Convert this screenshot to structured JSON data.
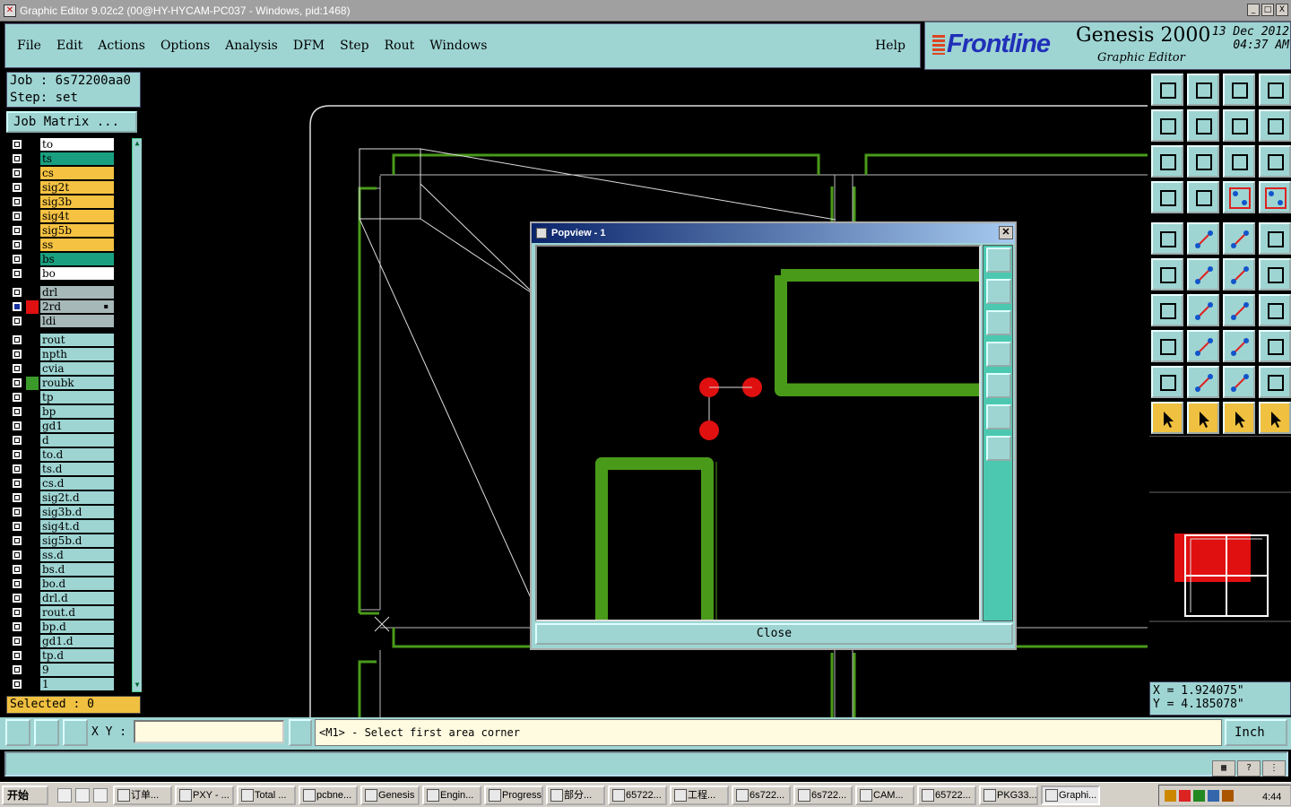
{
  "window": {
    "title": "Graphic Editor 9.02c2 (00@HY-HYCAM-PC037 - Windows, pid:1468)",
    "min": "_",
    "max": "□",
    "close": "X"
  },
  "menu": {
    "items": [
      "File",
      "Edit",
      "Actions",
      "Options",
      "Analysis",
      "DFM",
      "Step",
      "Rout",
      "Windows"
    ],
    "help": "Help"
  },
  "brand": {
    "logo": "Frontline",
    "product": "Genesis 2000",
    "subtitle": "Graphic Editor",
    "date": "13 Dec 2012",
    "time": "04:37 AM"
  },
  "job": {
    "job_label": "Job :",
    "job_name": "6s72200aa0",
    "step_label": "Step:",
    "step_name": "set",
    "matrix_button": "Job Matrix ..."
  },
  "layers": [
    {
      "name": "to",
      "color": "#ffffff",
      "sw": ""
    },
    {
      "name": "ts",
      "color": "#1aa080",
      "sw": ""
    },
    {
      "name": "cs",
      "color": "#f5c242",
      "sw": ""
    },
    {
      "name": "sig2t",
      "color": "#f5c242",
      "sw": ""
    },
    {
      "name": "sig3b",
      "color": "#f5c242",
      "sw": ""
    },
    {
      "name": "sig4t",
      "color": "#f5c242",
      "sw": ""
    },
    {
      "name": "sig5b",
      "color": "#f5c242",
      "sw": ""
    },
    {
      "name": "ss",
      "color": "#f5c242",
      "sw": ""
    },
    {
      "name": "bs",
      "color": "#1aa080",
      "sw": ""
    },
    {
      "name": "bo",
      "color": "#ffffff",
      "sw": ""
    },
    {
      "name": "drl",
      "color": "#a6b8b8",
      "sw": "",
      "gap": true
    },
    {
      "name": "2rd",
      "color": "#a6b8b8",
      "sw": "#e01010",
      "sel": true
    },
    {
      "name": "ldi",
      "color": "#a6b8b8",
      "sw": ""
    },
    {
      "name": "rout",
      "color": "#9ed5d3",
      "sw": "",
      "gap": true
    },
    {
      "name": "npth",
      "color": "#9ed5d3",
      "sw": ""
    },
    {
      "name": "cvia",
      "color": "#9ed5d3",
      "sw": ""
    },
    {
      "name": "roubk",
      "color": "#9ed5d3",
      "sw": "#3a9a2a"
    },
    {
      "name": "tp",
      "color": "#9ed5d3",
      "sw": ""
    },
    {
      "name": "bp",
      "color": "#9ed5d3",
      "sw": ""
    },
    {
      "name": "gd1",
      "color": "#9ed5d3",
      "sw": ""
    },
    {
      "name": "d",
      "color": "#9ed5d3",
      "sw": ""
    },
    {
      "name": "to.d",
      "color": "#9ed5d3",
      "sw": ""
    },
    {
      "name": "ts.d",
      "color": "#9ed5d3",
      "sw": ""
    },
    {
      "name": "cs.d",
      "color": "#9ed5d3",
      "sw": ""
    },
    {
      "name": "sig2t.d",
      "color": "#9ed5d3",
      "sw": ""
    },
    {
      "name": "sig3b.d",
      "color": "#9ed5d3",
      "sw": ""
    },
    {
      "name": "sig4t.d",
      "color": "#9ed5d3",
      "sw": ""
    },
    {
      "name": "sig5b.d",
      "color": "#9ed5d3",
      "sw": ""
    },
    {
      "name": "ss.d",
      "color": "#9ed5d3",
      "sw": ""
    },
    {
      "name": "bs.d",
      "color": "#9ed5d3",
      "sw": ""
    },
    {
      "name": "bo.d",
      "color": "#9ed5d3",
      "sw": ""
    },
    {
      "name": "drl.d",
      "color": "#9ed5d3",
      "sw": ""
    },
    {
      "name": "rout.d",
      "color": "#9ed5d3",
      "sw": ""
    },
    {
      "name": "bp.d",
      "color": "#9ed5d3",
      "sw": ""
    },
    {
      "name": "gd1.d",
      "color": "#9ed5d3",
      "sw": ""
    },
    {
      "name": "tp.d",
      "color": "#9ed5d3",
      "sw": ""
    },
    {
      "name": "9",
      "color": "#9ed5d3",
      "sw": ""
    },
    {
      "name": "1",
      "color": "#9ed5d3",
      "sw": ""
    }
  ],
  "selected": "Selected : 0",
  "popview": {
    "title": "Popview - 1",
    "close_button": "Close"
  },
  "coords": {
    "x": "X = 1.924075\"",
    "y": "Y = 4.185078\""
  },
  "bottom": {
    "xy_label": "X Y :",
    "xy_value": "",
    "message": "<M1> - Select first area corner",
    "units": "Inch"
  },
  "taskbar": {
    "start": "开始",
    "tasks": [
      "订单...",
      "PXY - ...",
      "Total ...",
      "pcbne...",
      "Genesis",
      "Engin...",
      "Progress",
      "部分...",
      "65722...",
      "工程...",
      "6s722...",
      "6s722...",
      "CAM...",
      "65722...",
      "PKG33...",
      "Graphi..."
    ],
    "clock": "4:44"
  },
  "colors": {
    "panel": "#9ed5d3",
    "trace": "#4a9a1a",
    "pad": "#e01010",
    "highlight": "#f0c040"
  }
}
